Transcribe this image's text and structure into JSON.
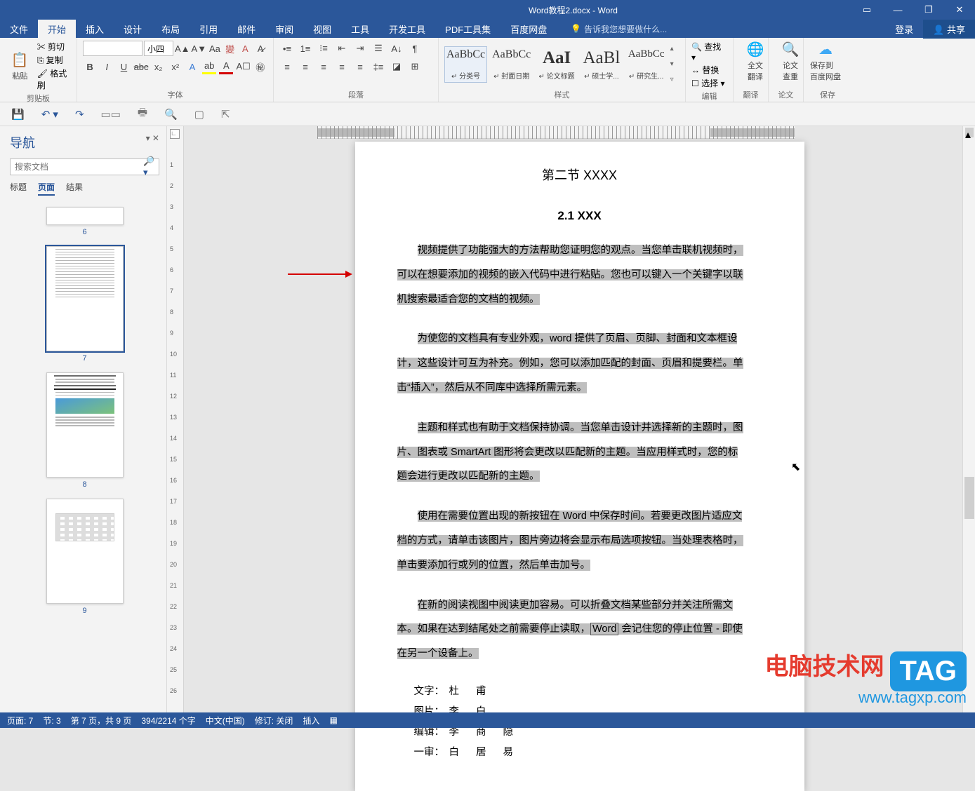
{
  "title_doc": "Word教程2.docx - Word",
  "titlebar_right": {
    "login": "登录",
    "share": "共享"
  },
  "tabs": {
    "file": "文件",
    "home": "开始",
    "insert": "插入",
    "design": "设计",
    "layout": "布局",
    "refs": "引用",
    "mail": "邮件",
    "review": "审阅",
    "view": "视图",
    "tools": "工具",
    "dev": "开发工具",
    "pdf": "PDF工具集",
    "baidu": "百度网盘"
  },
  "tell_me": "告诉我您想要做什么...",
  "groups": {
    "clipboard": {
      "label": "剪贴板",
      "cut": "剪切",
      "copy": "复制",
      "fmt": "格式刷",
      "paste": "粘贴"
    },
    "font": {
      "label": "字体",
      "name_placeholder": "",
      "size_value": "小四"
    },
    "para": {
      "label": "段落"
    },
    "styles": {
      "label": "样式",
      "items": [
        {
          "preview": "AaBbCc",
          "name": "↵ 分类号",
          "size": "16px"
        },
        {
          "preview": "AaBbCc",
          "name": "↵ 封面日期",
          "size": "16px"
        },
        {
          "preview": "AaI",
          "name": "↵ 论文标题",
          "size": "25px",
          "bold": true
        },
        {
          "preview": "AaBl",
          "name": "↵ 硕士学...",
          "size": "25px"
        },
        {
          "preview": "AaBbCc",
          "name": "↵ 研究生...",
          "size": "15px"
        }
      ]
    },
    "edit": {
      "label": "编辑",
      "find": "查找",
      "replace": "替换",
      "select": "选择"
    },
    "translate": {
      "label": "翻译",
      "btn": "全文\n翻译"
    },
    "paper": {
      "label": "论文",
      "btn": "论文\n查重"
    },
    "save": {
      "label": "保存",
      "btn": "保存到\n百度网盘"
    }
  },
  "nav": {
    "title": "导航",
    "search_placeholder": "搜索文档",
    "tabs": {
      "headings": "标题",
      "pages": "页面",
      "results": "结果"
    },
    "thumbs": [
      "6",
      "7",
      "8",
      "9"
    ]
  },
  "doc": {
    "section_title": "第二节  XXXX",
    "subsection": "2.1 XXX",
    "p1_a": "视频提供了功能强大的方法帮助您证明您的观点。当您单击联机视频时，",
    "p1_b": "可以在想要添加的视频的嵌入代码中进行粘贴。您也可以键入一个关键字以联",
    "p1_c": "机搜索最适合您的文档的视频。",
    "p2_a": "为使您的文档具有专业外观，word 提供了页眉、页脚、封面和文本框设",
    "p2_b": "计，这些设计可互为补充。例如，您可以添加匹配的封面、页眉和提要栏。单",
    "p2_c": "击“插入”，然后从不同库中选择所需元素。",
    "p3_a": "主题和样式也有助于文档保持协调。当您单击设计并选择新的主题时，图",
    "p3_b": "片、图表或  SmartArt  图形将会更改以匹配新的主题。当应用样式时，您的标",
    "p3_c": "题会进行更改以匹配新的主题。",
    "p4_a": "使用在需要位置出现的新按钮在  Word  中保存时间。若要更改图片适应文",
    "p4_b": "档的方式，请单击该图片，图片旁边将会显示布局选项按钮。当处理表格时，",
    "p4_c": "单击要添加行或列的位置，然后单击加号。",
    "p5_a": "在新的阅读视图中阅读更加容易。可以折叠文档某些部分并关注所需文",
    "p5_b_pre": "本。如果在达到结尾处之前需要停止读取，",
    "p5_b_word": "Word",
    "p5_b_post": " 会记住您的停止位置 - 即使",
    "p5_c": "在另一个设备上。",
    "credits": [
      {
        "lab": "文字：",
        "val": "杜    甫"
      },
      {
        "lab": "图片：",
        "val": "李    白"
      },
      {
        "lab": "编辑：",
        "val": "李 商 隐"
      },
      {
        "lab": "一审：",
        "val": "白 居 易"
      }
    ]
  },
  "status": {
    "page": "页面: 7",
    "section": "节: 3",
    "page_of": "第 7 页，共 9 页",
    "words": "394/2214 个字",
    "lang": "中文(中国)",
    "track": "修订: 关闭",
    "insert": "插入"
  },
  "watermark": {
    "cn": "电脑技术网",
    "tag": "TAG",
    "url": "www.tagxp.com"
  }
}
